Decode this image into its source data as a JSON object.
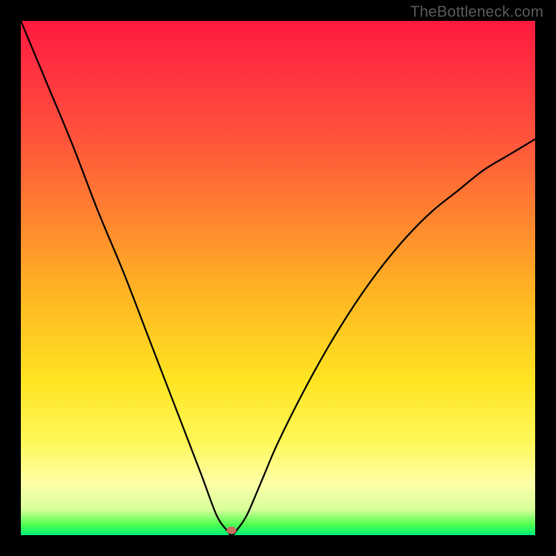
{
  "watermark": "TheBottleneck.com",
  "chart_data": {
    "type": "line",
    "title": "",
    "xlabel": "",
    "ylabel": "",
    "xlim": [
      0,
      100
    ],
    "ylim": [
      0,
      100
    ],
    "x": [
      0,
      5,
      10,
      15,
      20,
      25,
      30,
      35,
      38,
      40,
      41,
      42,
      44,
      47,
      50,
      55,
      60,
      65,
      70,
      75,
      80,
      85,
      90,
      95,
      100
    ],
    "y": [
      100,
      88,
      76,
      63,
      51,
      38,
      25,
      12,
      4,
      1,
      0,
      1,
      4,
      11,
      18,
      28,
      37,
      45,
      52,
      58,
      63,
      67,
      71,
      74,
      77
    ],
    "marker": {
      "x": 41,
      "y": 1
    }
  },
  "colors": {
    "curve": "#000000",
    "marker": "#cc6e62",
    "frame": "#000000"
  }
}
